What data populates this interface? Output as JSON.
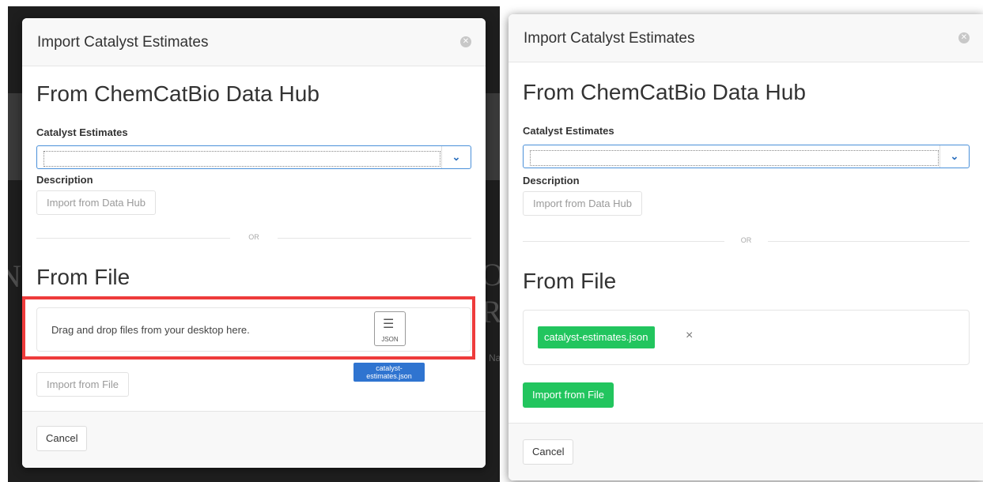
{
  "backdrop": {
    "ghost_left": "Ne",
    "ghost_right": "O, RE",
    "ghost_small": "Nat"
  },
  "left_modal": {
    "title": "Import Catalyst Estimates",
    "hub_heading": "From ChemCatBio Data Hub",
    "catalyst_label": "Catalyst Estimates",
    "catalyst_value": "",
    "description_label": "Description",
    "import_hub_label": "Import from Data Hub",
    "or_label": "OR",
    "file_heading": "From File",
    "dropzone_text": "Drag and drop files from your desktop here.",
    "dragged_file": {
      "icon": "json-file-icon",
      "icon_tag": "JSON",
      "name_line1": "catalyst-",
      "name_line2": "estimates.json"
    },
    "import_file_label": "Import from File",
    "cancel_label": "Cancel",
    "highlight_color": "#ee3b3b"
  },
  "right_modal": {
    "title": "Import Catalyst Estimates",
    "hub_heading": "From ChemCatBio Data Hub",
    "catalyst_label": "Catalyst Estimates",
    "catalyst_value": "",
    "description_label": "Description",
    "import_hub_label": "Import from Data Hub",
    "or_label": "OR",
    "file_heading": "From File",
    "selected_file": "catalyst-estimates.json",
    "remove_icon": "×",
    "import_file_label": "Import from File",
    "cancel_label": "Cancel",
    "accent_color": "#22c55e"
  }
}
